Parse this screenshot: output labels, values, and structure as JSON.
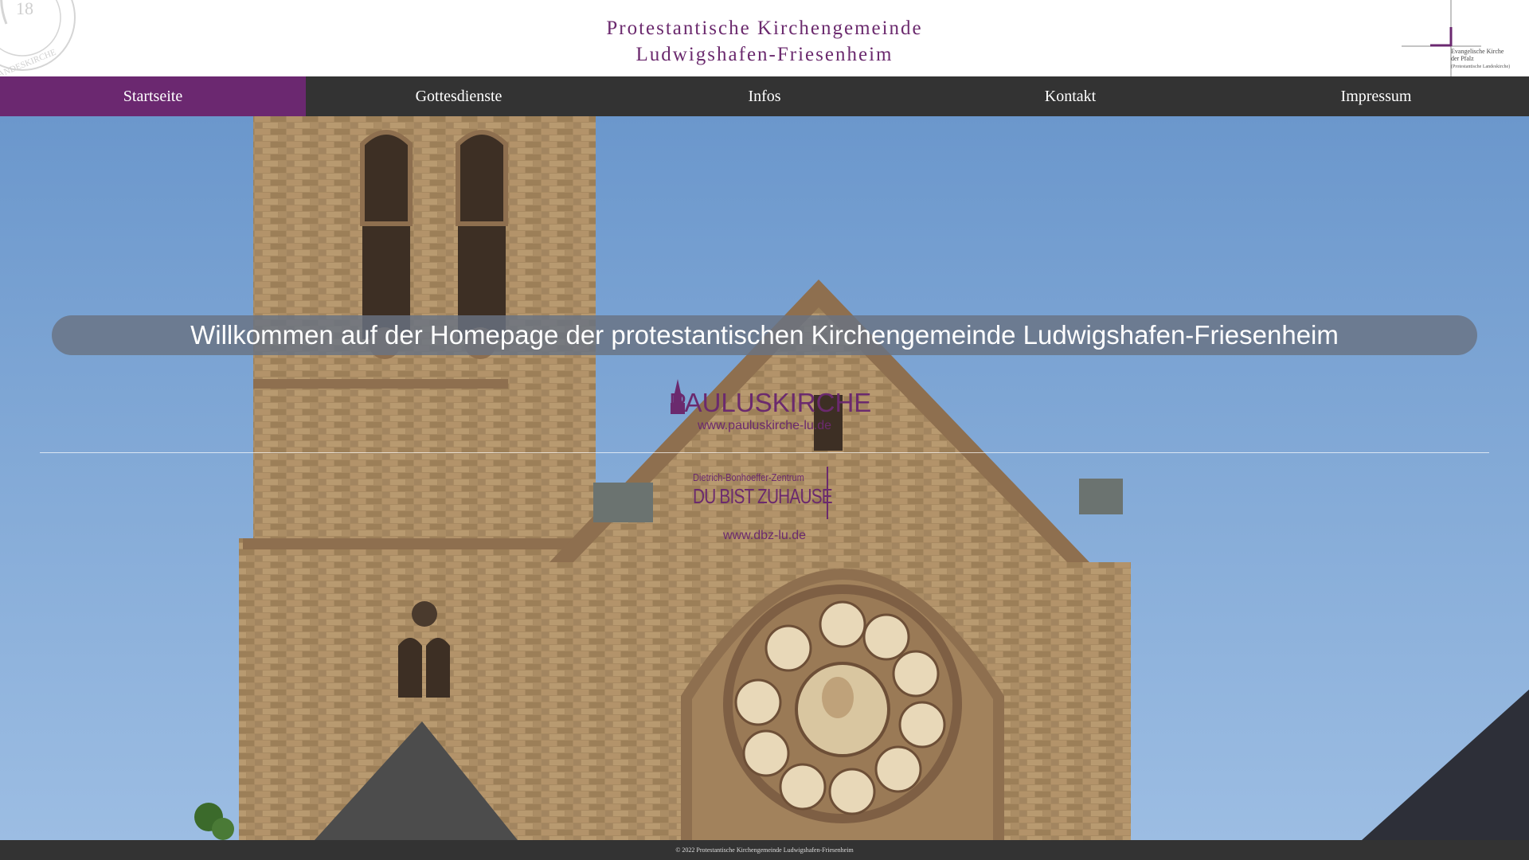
{
  "header": {
    "title_line1": "Protestantische Kirchengemeinde",
    "title_line2": "Ludwigshafen-Friesenheim",
    "seal_number": "18",
    "seal_text": "HE LANDESKIRCHE",
    "church_logo_line1": "Evangelische Kirche",
    "church_logo_line2": "der Pfalz",
    "church_logo_line3": "(Protestantische Landeskirche)"
  },
  "nav": {
    "items": [
      {
        "label": "Startseite",
        "active": true
      },
      {
        "label": "Gottesdienste",
        "active": false
      },
      {
        "label": "Infos",
        "active": false
      },
      {
        "label": "Kontakt",
        "active": false
      },
      {
        "label": "Impressum",
        "active": false
      }
    ]
  },
  "hero": {
    "welcome": "Willkommen auf der Homepage der protestantischen Kirchengemeinde Ludwigshafen-Friesenheim",
    "paulus": {
      "name": "PAULUSKIRCHE",
      "url": "www.pauluskirche-lu.de"
    },
    "dbz": {
      "subtitle": "Dietrich-Bonhoeffer-Zentrum",
      "slogan": "DU BIST ZUHAUSE",
      "url": "www.dbz-lu.de"
    }
  },
  "footer": {
    "copyright": "© 2022 Protestantische Kirchengemeinde Ludwigshafen-Friesenheim"
  },
  "colors": {
    "accent": "#6b2870",
    "nav_bg": "#333333",
    "title": "#6b2a6e"
  }
}
